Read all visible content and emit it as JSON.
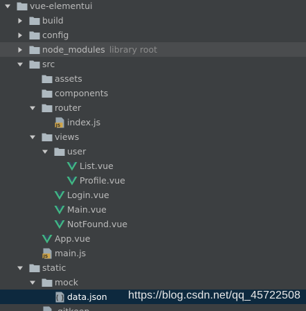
{
  "tree": {
    "items": [
      {
        "label": "vue-elementui",
        "indent": 0,
        "arrow": "down",
        "icon": "folder-icon"
      },
      {
        "label": "build",
        "indent": 1,
        "arrow": "right",
        "icon": "folder-icon"
      },
      {
        "label": "config",
        "indent": 1,
        "arrow": "right",
        "icon": "folder-icon"
      },
      {
        "label": "node_modules",
        "hint": "library root",
        "indent": 1,
        "arrow": "right",
        "icon": "folder-icon",
        "muted": true
      },
      {
        "label": "src",
        "indent": 1,
        "arrow": "down",
        "icon": "folder-icon"
      },
      {
        "label": "assets",
        "indent": 2,
        "arrow": "none",
        "icon": "folder-icon"
      },
      {
        "label": "components",
        "indent": 2,
        "arrow": "none",
        "icon": "folder-icon"
      },
      {
        "label": "router",
        "indent": 2,
        "arrow": "down",
        "icon": "folder-icon"
      },
      {
        "label": "index.js",
        "indent": 3,
        "arrow": "none",
        "icon": "js-file-icon"
      },
      {
        "label": "views",
        "indent": 2,
        "arrow": "down",
        "icon": "folder-icon"
      },
      {
        "label": "user",
        "indent": 3,
        "arrow": "down",
        "icon": "folder-icon"
      },
      {
        "label": "List.vue",
        "indent": 4,
        "arrow": "none",
        "icon": "vue-file-icon"
      },
      {
        "label": "Profile.vue",
        "indent": 4,
        "arrow": "none",
        "icon": "vue-file-icon"
      },
      {
        "label": "Login.vue",
        "indent": 3,
        "arrow": "none",
        "icon": "vue-file-icon"
      },
      {
        "label": "Main.vue",
        "indent": 3,
        "arrow": "none",
        "icon": "vue-file-icon"
      },
      {
        "label": "NotFound.vue",
        "indent": 3,
        "arrow": "none",
        "icon": "vue-file-icon"
      },
      {
        "label": "App.vue",
        "indent": 2,
        "arrow": "none",
        "icon": "vue-file-icon"
      },
      {
        "label": "main.js",
        "indent": 2,
        "arrow": "none",
        "icon": "js-file-icon"
      },
      {
        "label": "static",
        "indent": 1,
        "arrow": "down",
        "icon": "folder-icon"
      },
      {
        "label": "mock",
        "indent": 2,
        "arrow": "down",
        "icon": "folder-icon"
      },
      {
        "label": "data.json",
        "indent": 3,
        "arrow": "none",
        "icon": "json-file-icon",
        "selected": true
      },
      {
        "label": ".gitkeep",
        "indent": 2,
        "arrow": "none",
        "icon": "file-icon"
      }
    ]
  },
  "watermark": "https://blog.csdn.net/qq_45722508",
  "colors": {
    "background": "#3c3f41",
    "selected_row": "#0d293e",
    "muted_row": "#4a4c4e",
    "folder": "#aeb9c0",
    "vue_green": "#41b883",
    "js_yellow": "#cfa54a"
  }
}
